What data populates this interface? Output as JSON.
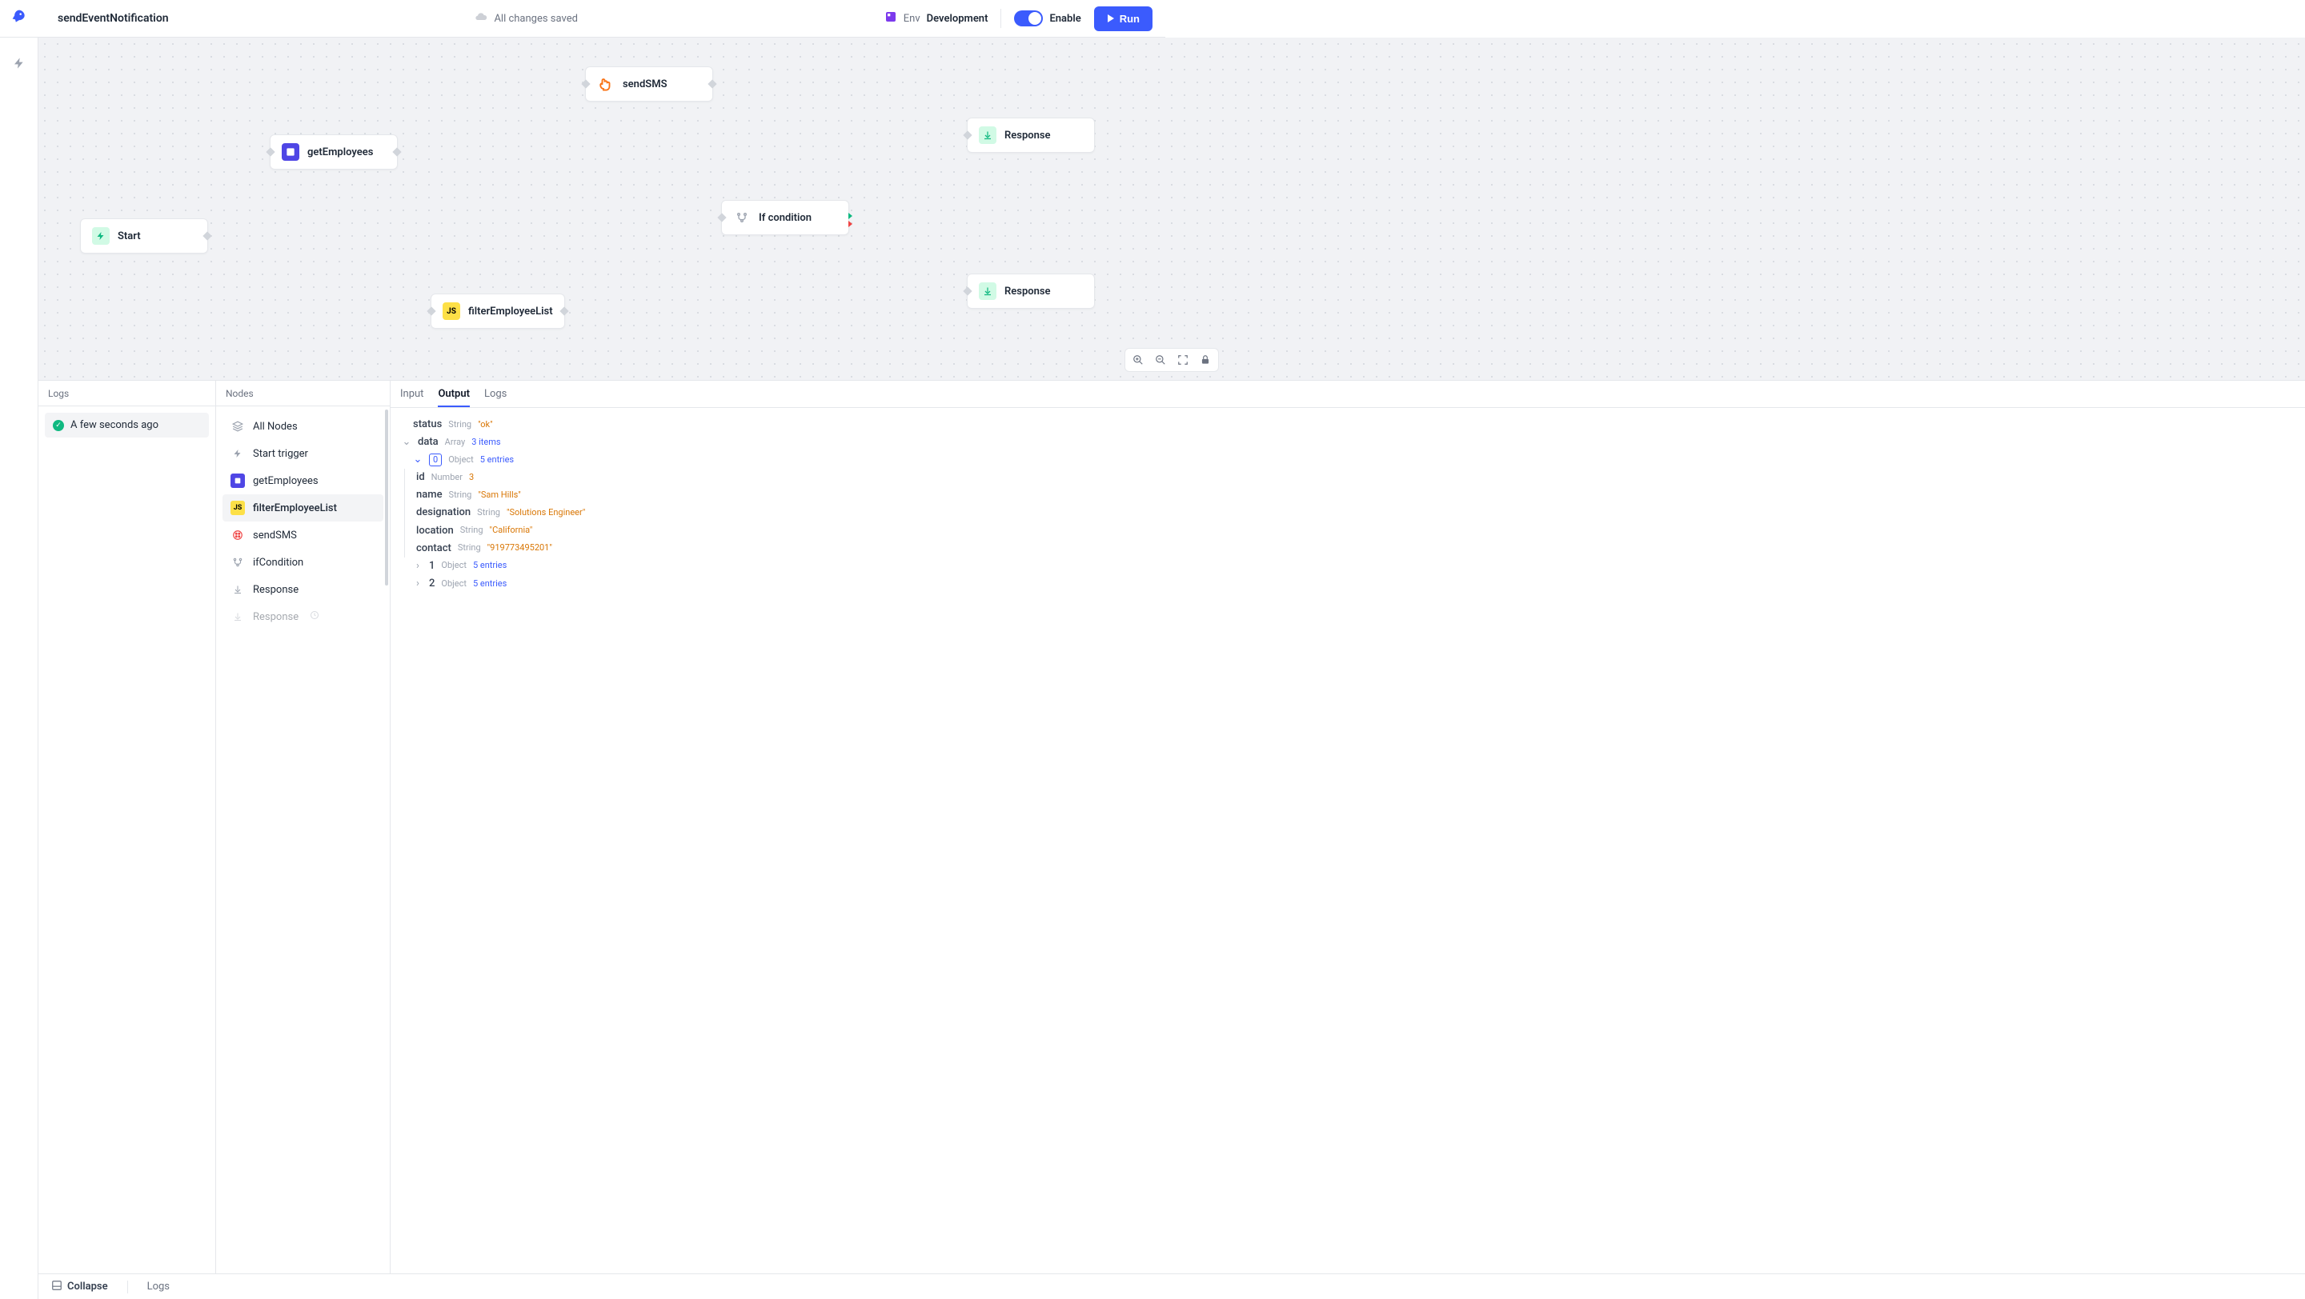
{
  "header": {
    "title": "sendEventNotification",
    "save_status": "All changes saved",
    "env_label": "Env",
    "env_value": "Development",
    "enable_label": "Enable",
    "run_label": "Run"
  },
  "canvas": {
    "nodes": {
      "start": "Start",
      "getEmployees": "getEmployees",
      "filterEmployeeList": "filterEmployeeList",
      "sendSMS": "sendSMS",
      "ifCondition": "If condition",
      "response1": "Response",
      "response2": "Response"
    },
    "toolbar": [
      "zoom-in",
      "zoom-out",
      "fit",
      "lock"
    ]
  },
  "panels": {
    "logs": {
      "title": "Logs",
      "items": [
        {
          "status": "ok",
          "label": "A few seconds ago"
        }
      ]
    },
    "nodes": {
      "title": "Nodes",
      "items": [
        {
          "icon": "layers",
          "label": "All Nodes"
        },
        {
          "icon": "bolt",
          "label": "Start trigger"
        },
        {
          "icon": "blue",
          "label": "getEmployees"
        },
        {
          "icon": "yellow",
          "label": "filterEmployeeList",
          "active": true
        },
        {
          "icon": "red",
          "label": "sendSMS"
        },
        {
          "icon": "branch",
          "label": "ifCondition"
        },
        {
          "icon": "response",
          "label": "Response"
        },
        {
          "icon": "response",
          "label": "Response",
          "faded": true
        }
      ]
    },
    "output": {
      "tabs": {
        "input": "Input",
        "output": "Output",
        "logs": "Logs"
      },
      "active_tab": "output",
      "tree": {
        "status": {
          "type": "String",
          "value": "\"ok\""
        },
        "data": {
          "type": "Array",
          "meta": "3 items",
          "items": [
            {
              "type": "Object",
              "meta": "5 entries",
              "expanded": true,
              "fields": {
                "id": {
                  "type": "Number",
                  "value": "3"
                },
                "name": {
                  "type": "String",
                  "value": "\"Sam Hills\""
                },
                "designation": {
                  "type": "String",
                  "value": "\"Solutions Engineer\""
                },
                "location": {
                  "type": "String",
                  "value": "\"California\""
                },
                "contact": {
                  "type": "String",
                  "value": "\"919773495201\""
                }
              }
            },
            {
              "index": "1",
              "type": "Object",
              "meta": "5 entries"
            },
            {
              "index": "2",
              "type": "Object",
              "meta": "5 entries"
            }
          ]
        }
      }
    }
  },
  "footer": {
    "collapse": "Collapse",
    "logs": "Logs"
  }
}
